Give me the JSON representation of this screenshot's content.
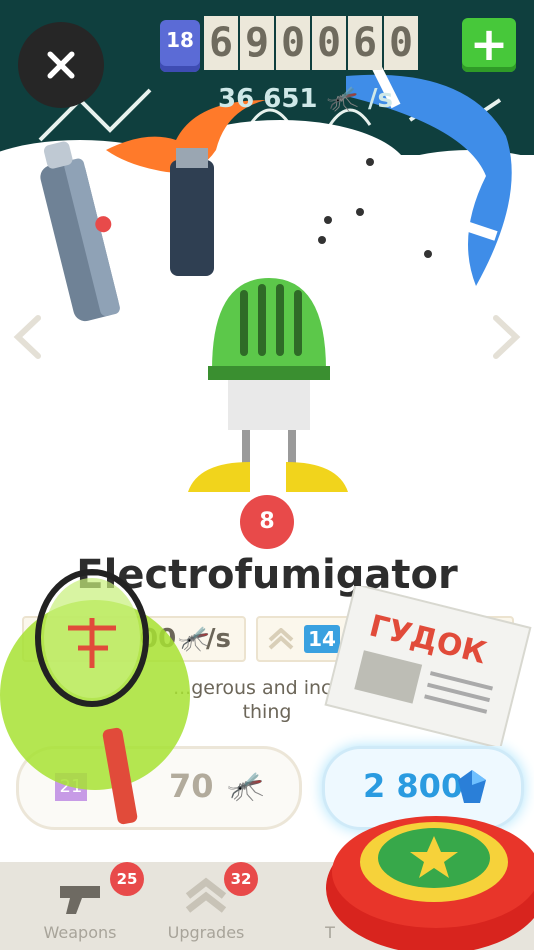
{
  "header": {
    "close_icon": "close-icon",
    "level": "18",
    "counter_digits": [
      "6",
      "9",
      "0",
      "0",
      "6",
      "0"
    ],
    "rate_value": "36 651",
    "rate_unit": "/s",
    "add_label": "+"
  },
  "item": {
    "name": "Electrofumigator",
    "level": "8",
    "description_line1": "...gerous and inco...",
    "description_line2": "thing"
  },
  "stats": {
    "left_value": "00",
    "left_unit": "/s",
    "right_level": "14",
    "right_unit": "/s"
  },
  "buy": {
    "left_level": "21",
    "left_price": "70",
    "right_price": "2 800"
  },
  "tabs": [
    {
      "label": "Weapons",
      "badge": "25"
    },
    {
      "label": "Upgrades",
      "badge": "32"
    },
    {
      "label": "T",
      "badge": ""
    }
  ],
  "colors": {
    "accent_green": "#47c83a",
    "accent_blue": "#2a9be0",
    "badge_red": "#e84a4a",
    "dark_bg": "#0f3f3e"
  }
}
